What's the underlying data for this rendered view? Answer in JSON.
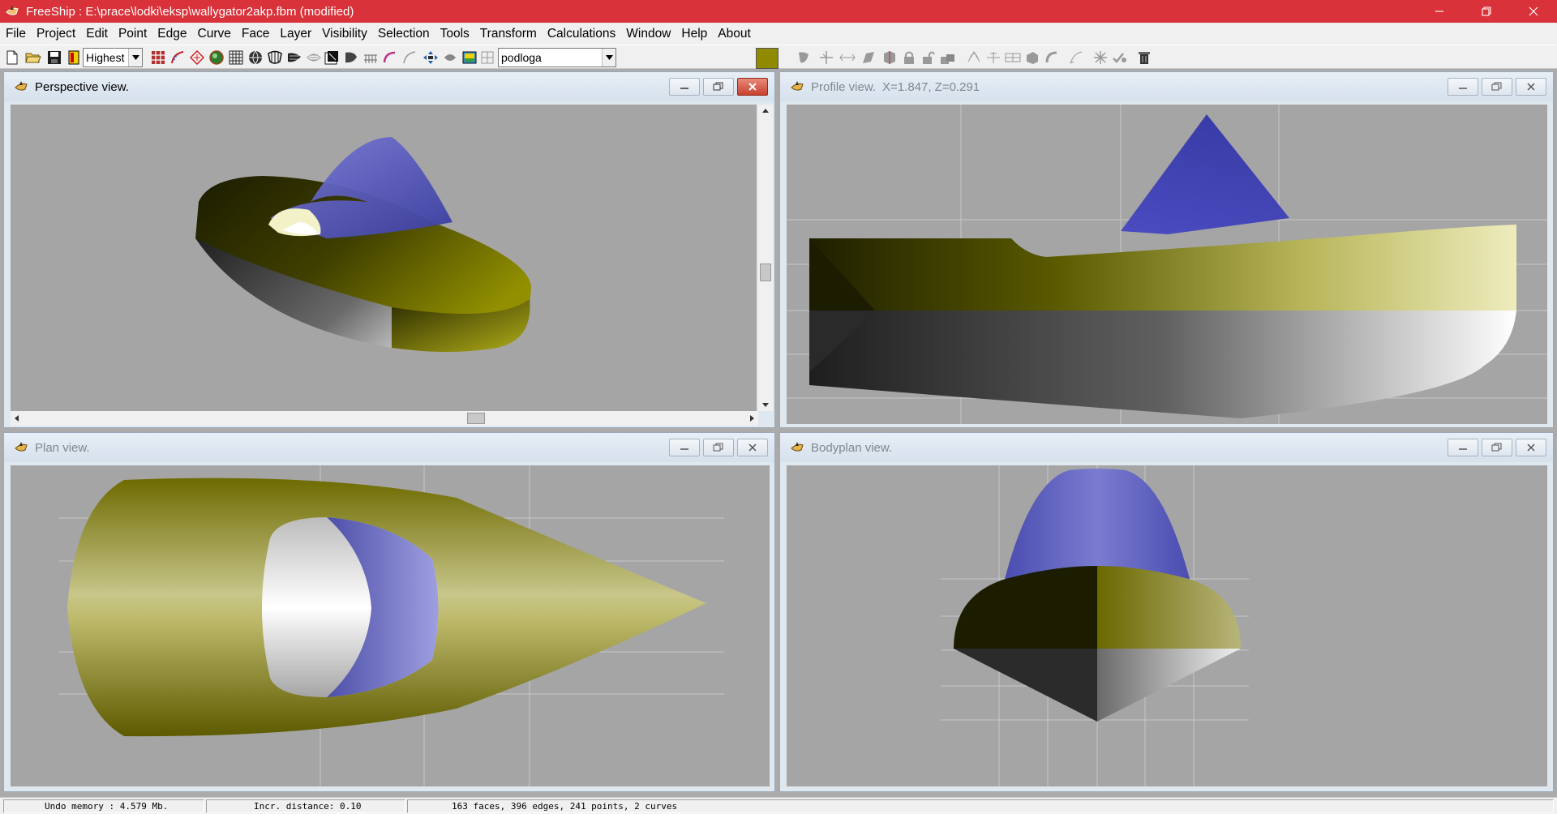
{
  "window": {
    "title": "FreeShip : E:\\prace\\lodki\\eksp\\wallygator2akp.fbm (modified)",
    "title_color": "#d9323a"
  },
  "menu": [
    {
      "label": "File"
    },
    {
      "label": "Project"
    },
    {
      "label": "Edit"
    },
    {
      "label": "Point"
    },
    {
      "label": "Edge"
    },
    {
      "label": "Curve"
    },
    {
      "label": "Face"
    },
    {
      "label": "Layer"
    },
    {
      "label": "Visibility"
    },
    {
      "label": "Selection"
    },
    {
      "label": "Tools"
    },
    {
      "label": "Transform"
    },
    {
      "label": "Calculations"
    },
    {
      "label": "Window"
    },
    {
      "label": "Help"
    },
    {
      "label": "About"
    }
  ],
  "toolbar": {
    "precision_value": "Highest",
    "layer_value": "podloga",
    "layer_color": "#8f8a00"
  },
  "views": {
    "perspective": {
      "title": "Perspective view."
    },
    "profile": {
      "title": "Profile view.",
      "coords": "X=1.847,   Z=0.291"
    },
    "plan": {
      "title": "Plan view."
    },
    "bodyplan": {
      "title": "Bodyplan view."
    }
  },
  "status": {
    "undo": "Undo memory : 4.579 Mb.",
    "incr": "Incr. distance: 0.10",
    "counts": "163 faces, 396 edges, 241 points, 2 curves"
  }
}
